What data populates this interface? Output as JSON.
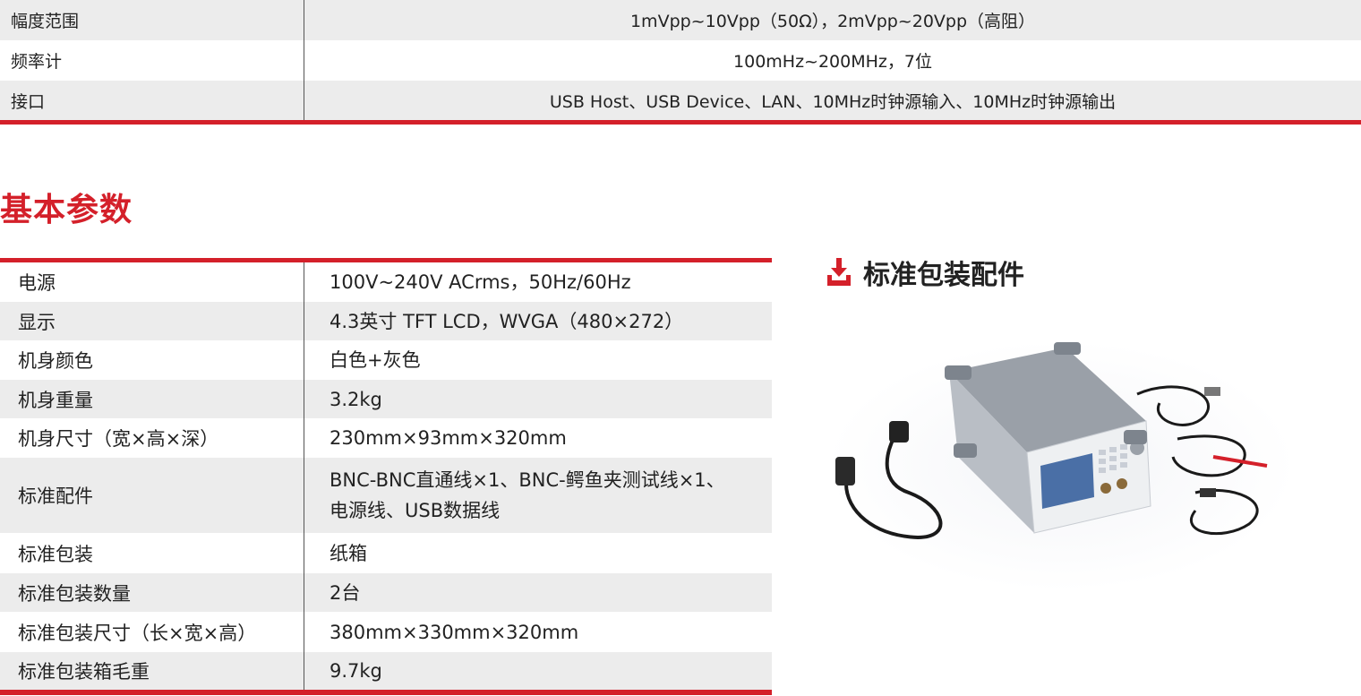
{
  "top_specs": [
    {
      "label": "幅度范围",
      "value": "1mVpp~10Vpp（50Ω），2mVpp~20Vpp（高阻）"
    },
    {
      "label": "频率计",
      "value": "100mHz~200MHz，7位"
    },
    {
      "label": "接口",
      "value": "USB Host、USB Device、LAN、10MHz时钟源输入、10MHz时钟源输出"
    }
  ],
  "section_title": "基本参数",
  "basic_params": [
    {
      "label": "电源",
      "value": "100V~240V ACrms，50Hz/60Hz"
    },
    {
      "label": "显示",
      "value": "4.3英寸 TFT LCD，WVGA（480×272）"
    },
    {
      "label": "机身颜色",
      "value": "白色+灰色"
    },
    {
      "label": "机身重量",
      "value": "3.2kg"
    },
    {
      "label": "机身尺寸（宽×高×深）",
      "value": "230mm×93mm×320mm"
    },
    {
      "label": "标准配件",
      "value": "BNC-BNC直通线×1、BNC-鳄鱼夹测试线×1、",
      "value2": "电源线、USB数据线"
    },
    {
      "label": "标准包装",
      "value": "纸箱"
    },
    {
      "label": "标准包装数量",
      "value": "2台"
    },
    {
      "label": "标准包装尺寸（长×宽×高）",
      "value": "380mm×330mm×320mm"
    },
    {
      "label": "标准包装箱毛重",
      "value": "9.7kg"
    }
  ],
  "accessory_header": {
    "title": "标准包装配件",
    "icon": "download-tray-icon"
  },
  "colors": {
    "accent": "#d4202a",
    "row_alt": "#ececec"
  }
}
